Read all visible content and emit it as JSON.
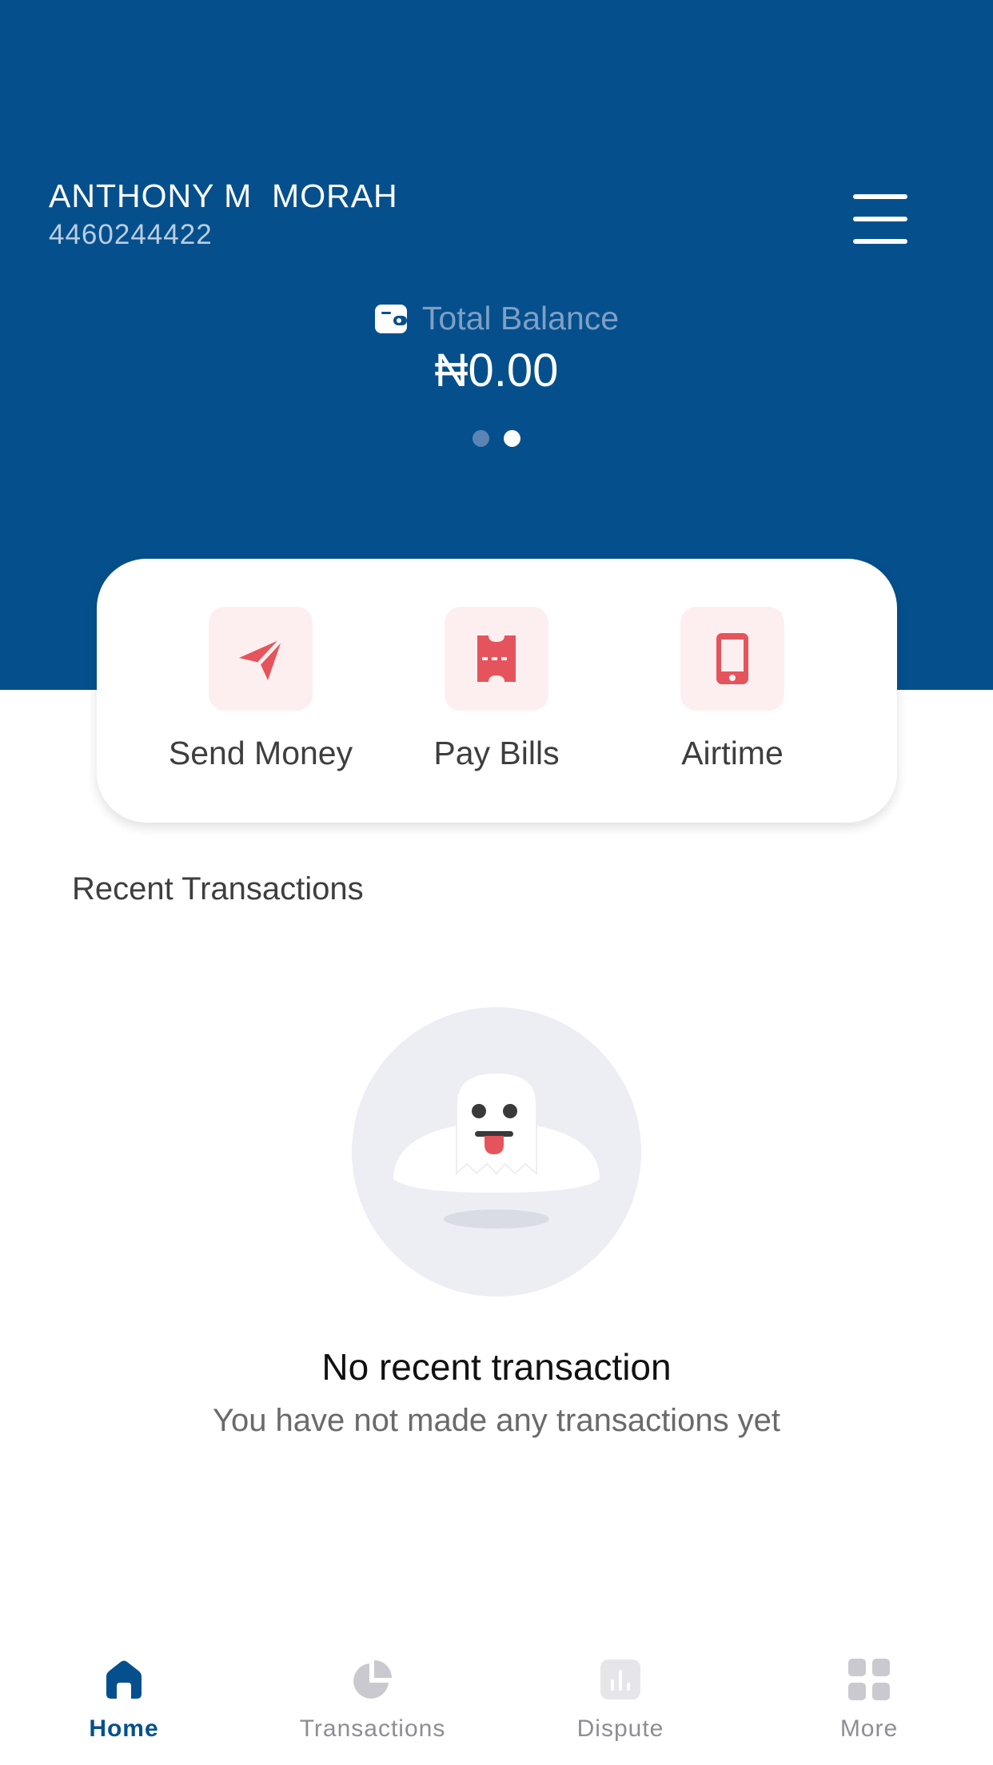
{
  "header": {
    "user_name": "ANTHONY M  MORAH",
    "account_number": "4460244422",
    "balance_label": "Total Balance",
    "balance_amount": "₦0.00",
    "carousel": {
      "count": 2,
      "active_index": 1
    },
    "background_color": "#05508c"
  },
  "actions": [
    {
      "label": "Send Money",
      "icon": "send-icon"
    },
    {
      "label": "Pay Bills",
      "icon": "bill-icon"
    },
    {
      "label": "Airtime",
      "icon": "phone-icon"
    }
  ],
  "recent": {
    "title": "Recent Transactions",
    "empty_title": "No recent transaction",
    "empty_subtitle": "You have not made any transactions yet",
    "illustration": "ghost-icon"
  },
  "nav": {
    "items": [
      {
        "label": "Home",
        "icon": "home-icon",
        "active": true
      },
      {
        "label": "Transactions",
        "icon": "pie-chart-icon",
        "active": false
      },
      {
        "label": "Dispute",
        "icon": "dispute-icon",
        "active": false
      },
      {
        "label": "More",
        "icon": "grid-icon",
        "active": false
      }
    ]
  },
  "colors": {
    "primary": "#05508c",
    "accent": "#e5545c",
    "accent_soft": "#fdeff0",
    "inactive": "#c9c9cf"
  }
}
